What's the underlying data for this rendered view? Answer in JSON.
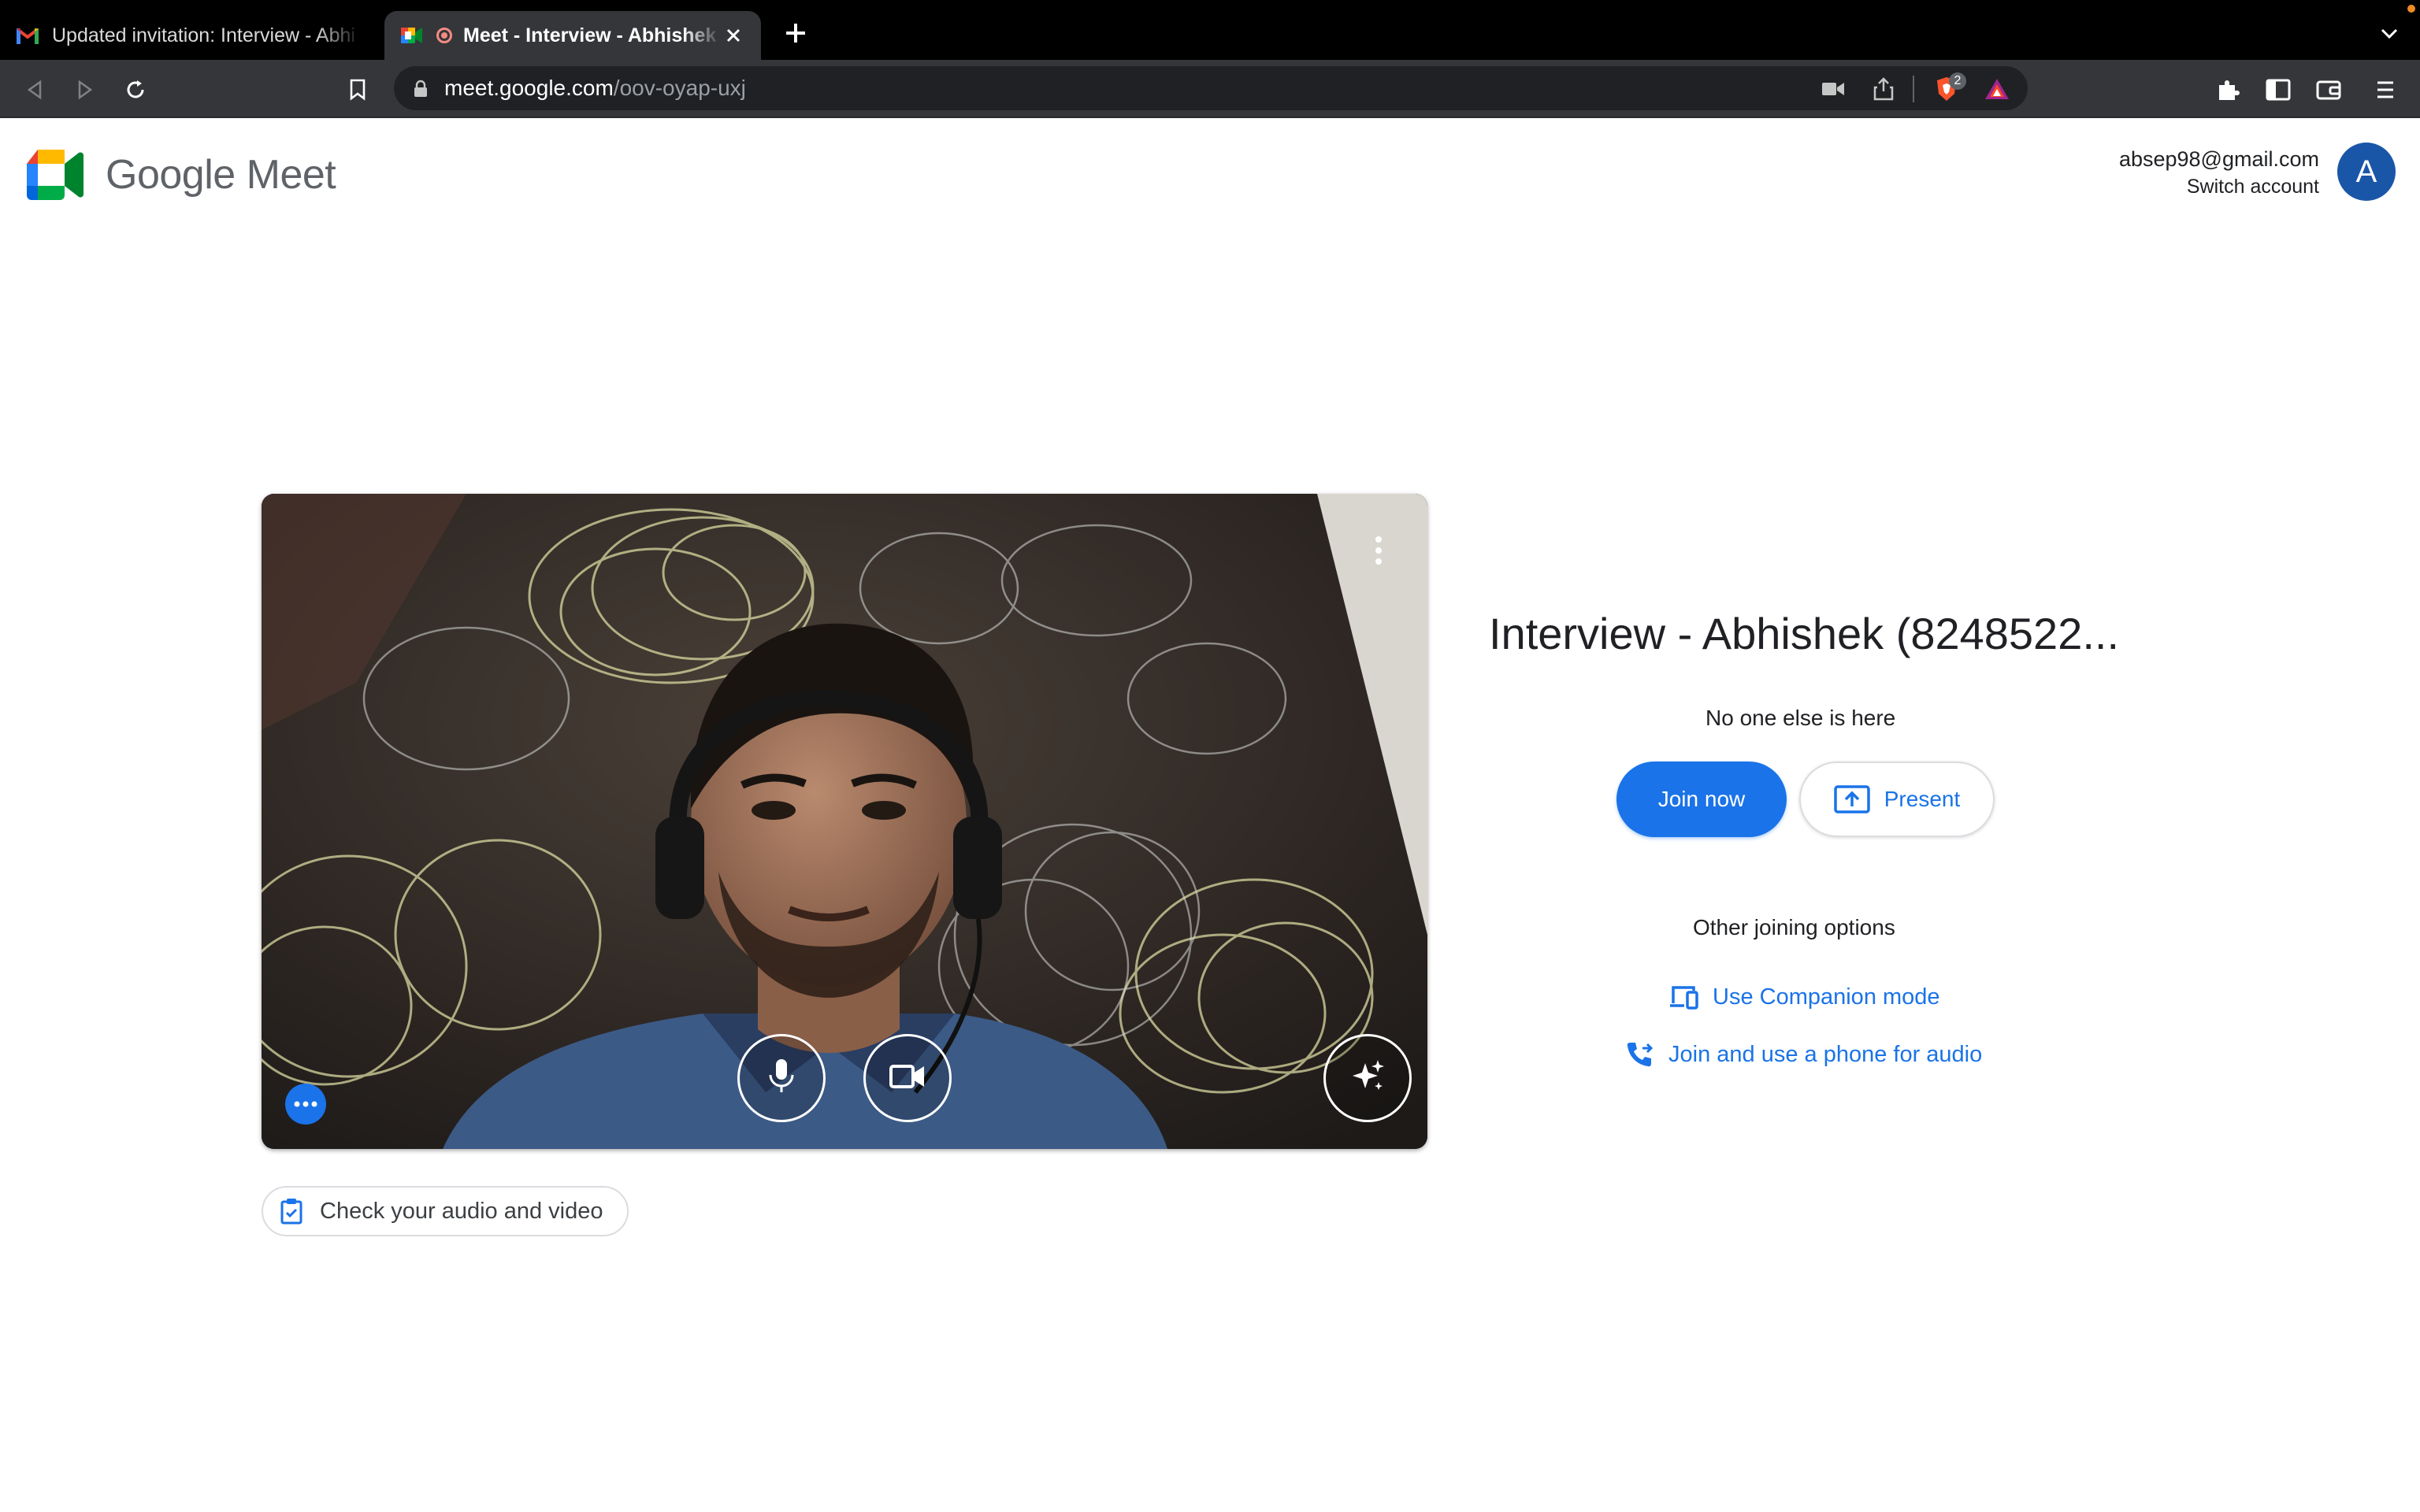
{
  "browser": {
    "tabs": [
      {
        "title": "Updated invitation: Interview - Abhi",
        "favicon": "gmail-icon",
        "active": false
      },
      {
        "title": "Meet - Interview - Abhishek (",
        "favicon": "meet-icon",
        "active": true,
        "recording_indicator": true
      }
    ],
    "url_host": "meet.google.com",
    "url_path": "/oov-oyap-uxj",
    "extension_badge": "2"
  },
  "header": {
    "brand": "Google Meet",
    "account_email": "absep98@gmail.com",
    "switch_account": "Switch account",
    "avatar_initial": "A"
  },
  "preview": {
    "mic_state": "on",
    "camera_state": "on",
    "check_audio_video": "Check your audio and video"
  },
  "join_panel": {
    "meeting_title": "Interview - Abhishek (8248522...",
    "status": "No one else is here",
    "join_now": "Join now",
    "present": "Present",
    "other_options_title": "Other joining options",
    "companion_mode": "Use Companion mode",
    "phone_audio": "Join and use a phone for audio"
  },
  "colors": {
    "accent": "#1a73e8",
    "avatar_bg": "#1a56a8",
    "tab_strip": "#000000",
    "toolbar": "#35363a"
  }
}
